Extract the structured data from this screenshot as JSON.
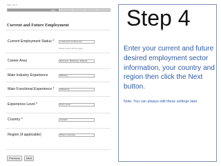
{
  "form": {
    "step_label": "Step 4 of 8",
    "progress_text": "50%",
    "progress_fraction": 0.5,
    "section_title": "Current and Future Employment",
    "fields": [
      {
        "label": "Current Employment Status *",
        "value": "Looking for employment",
        "hint": "Please select all that apply"
      },
      {
        "label": "Career Area",
        "value": "Business, Marketing, Material"
      },
      {
        "label": "Main Industry Experience",
        "value": "Banking"
      },
      {
        "label": "Main Functional Experience *",
        "value": "Marketing"
      },
      {
        "label": "Experience Level *",
        "value": "Entry Level"
      },
      {
        "label": "Country *",
        "value": "Canada"
      },
      {
        "label": "Region (if applicable)",
        "value": "British Columbia"
      }
    ],
    "buttons": {
      "previous": "Previous",
      "next": "Next"
    }
  },
  "panel": {
    "title": "Step 4",
    "subtitle": "Current & Future Employment",
    "instructions": "Enter your current and future desired employment sector information, your country and region then click the Next button.",
    "note": "Note: You can always edit these settings later."
  },
  "colors": {
    "accent_text": "#2f5aa6",
    "panel_border": "#7a8fb8",
    "progress_fill": "#9a9a9a"
  }
}
